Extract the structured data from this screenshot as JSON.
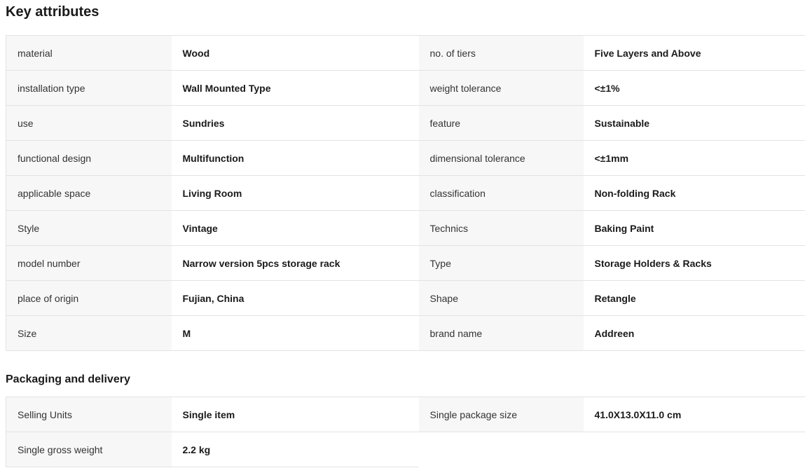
{
  "key_attributes": {
    "title": "Key attributes",
    "rows": [
      [
        {
          "label": "material",
          "value": "Wood"
        },
        {
          "label": "no. of tiers",
          "value": "Five Layers and Above"
        }
      ],
      [
        {
          "label": "installation type",
          "value": "Wall Mounted Type"
        },
        {
          "label": "weight tolerance",
          "value": "<±1%"
        }
      ],
      [
        {
          "label": "use",
          "value": "Sundries"
        },
        {
          "label": "feature",
          "value": "Sustainable"
        }
      ],
      [
        {
          "label": "functional design",
          "value": "Multifunction"
        },
        {
          "label": "dimensional tolerance",
          "value": "<±1mm"
        }
      ],
      [
        {
          "label": "applicable space",
          "value": "Living Room"
        },
        {
          "label": "classification",
          "value": "Non-folding Rack"
        }
      ],
      [
        {
          "label": "Style",
          "value": "Vintage"
        },
        {
          "label": "Technics",
          "value": "Baking Paint"
        }
      ],
      [
        {
          "label": "model number",
          "value": "Narrow version 5pcs storage rack"
        },
        {
          "label": "Type",
          "value": "Storage Holders & Racks"
        }
      ],
      [
        {
          "label": "place of origin",
          "value": "Fujian, China"
        },
        {
          "label": "Shape",
          "value": "Retangle"
        }
      ],
      [
        {
          "label": "Size",
          "value": "M"
        },
        {
          "label": "brand name",
          "value": "Addreen"
        }
      ]
    ]
  },
  "packaging": {
    "title": "Packaging and delivery",
    "rows": [
      [
        {
          "label": "Selling Units",
          "value": "Single item"
        },
        {
          "label": "Single package size",
          "value": "41.0X13.0X11.0 cm"
        }
      ],
      [
        {
          "label": "Single gross weight",
          "value": "2.2 kg"
        }
      ]
    ]
  }
}
